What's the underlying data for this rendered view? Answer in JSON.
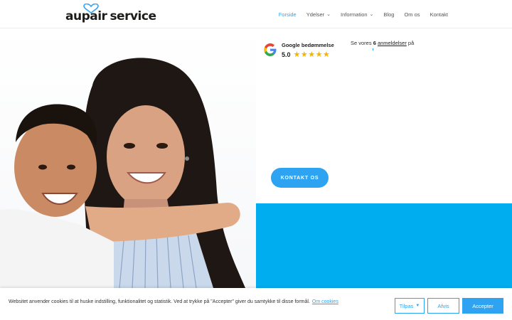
{
  "brand": {
    "logo_part1": "aupair",
    "logo_part2": "service",
    "accent_color": "#2ea3f2",
    "panel_color": "#00aeef"
  },
  "nav": {
    "items": [
      {
        "label": "Forside",
        "active": true,
        "dropdown": false
      },
      {
        "label": "Ydelser",
        "active": false,
        "dropdown": true
      },
      {
        "label": "Information",
        "active": false,
        "dropdown": true
      },
      {
        "label": "Blog",
        "active": false,
        "dropdown": false
      },
      {
        "label": "Om os",
        "active": false,
        "dropdown": false
      },
      {
        "label": "Kontakt",
        "active": false,
        "dropdown": false
      }
    ]
  },
  "review": {
    "title": "Google bedømmelse",
    "score": "5.0",
    "stars": "★★★★★",
    "link_prefix": "Se vores",
    "count": "6",
    "link_text": "anmeldelser",
    "link_suffix": "på",
    "icon": "google-g-icon"
  },
  "hero": {
    "cta_label": "KONTAKT OS",
    "photo": "mother-and-child-photo"
  },
  "cookie": {
    "text": "Websitet anvender cookies til at huske indstilling, funktionalitet og statistik. Ved at trykke på \"Accepter\" giver du samtykke til disse formål.",
    "link": "Om cookies",
    "tilpas_label": "Tilpas",
    "afvis_label": "Afvis",
    "accept_label": "Accepter"
  }
}
